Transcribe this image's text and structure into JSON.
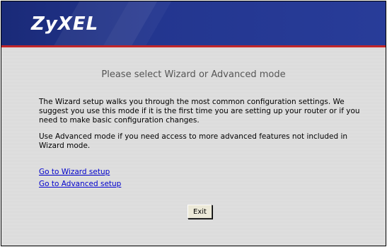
{
  "header": {
    "logo_text": "ZyXEL",
    "background_color": "#23368f",
    "accent_line_color": "#c1262a"
  },
  "main": {
    "title": "Please select Wizard or Advanced mode",
    "paragraph_1": "The Wizard setup walks you through the most common configuration settings. We suggest you use this mode if it is the first time you are setting up your router or if you need to make basic configuration changes.",
    "paragraph_2": "Use Advanced mode if you need access to more advanced features not included in Wizard mode.",
    "links": {
      "wizard": "Go to Wizard setup",
      "advanced": "Go to Advanced setup"
    },
    "exit_button_label": "Exit"
  }
}
